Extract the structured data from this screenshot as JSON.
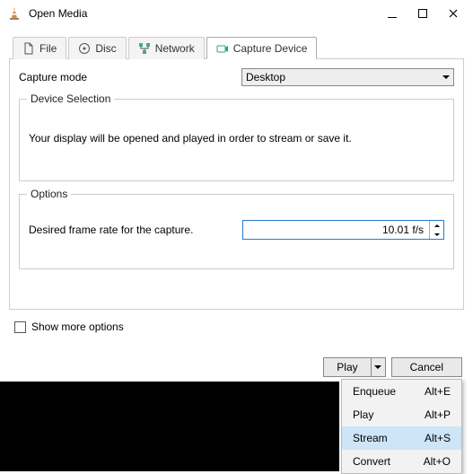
{
  "window": {
    "title": "Open Media"
  },
  "tabs": [
    {
      "label": "File"
    },
    {
      "label": "Disc"
    },
    {
      "label": "Network"
    },
    {
      "label": "Capture Device"
    }
  ],
  "capture": {
    "mode_label": "Capture mode",
    "mode_value": "Desktop",
    "device_selection": {
      "legend": "Device Selection",
      "hint": "Your display will be opened and played in order to stream or save it."
    },
    "options": {
      "legend": "Options",
      "fps_label": "Desired frame rate for the capture.",
      "fps_value": "10.01 f/s"
    }
  },
  "more_options": "Show more options",
  "footer": {
    "play": "Play",
    "cancel": "Cancel"
  },
  "menu": [
    {
      "label": "Enqueue",
      "accel": "Alt+E"
    },
    {
      "label": "Play",
      "accel": "Alt+P"
    },
    {
      "label": "Stream",
      "accel": "Alt+S"
    },
    {
      "label": "Convert",
      "accel": "Alt+O"
    }
  ]
}
